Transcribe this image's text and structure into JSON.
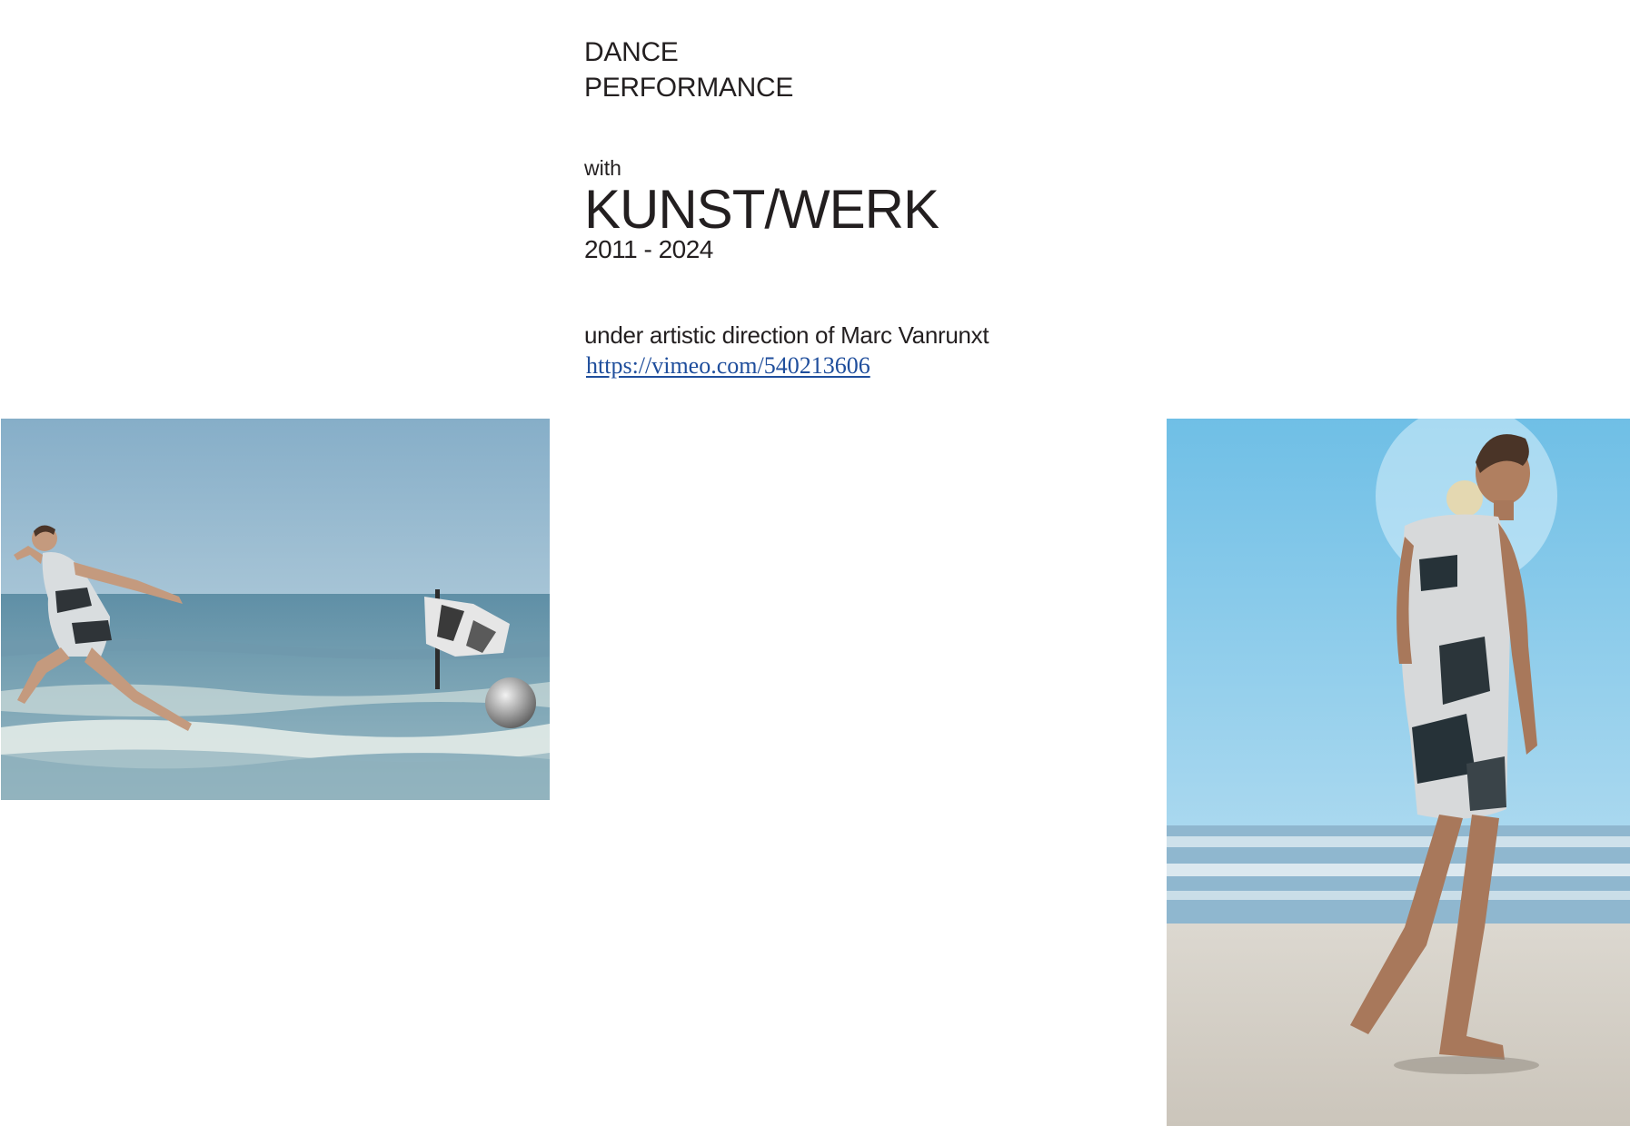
{
  "header": {
    "line1": "DANCE",
    "line2": "PERFORMANCE"
  },
  "intro": {
    "with": "with",
    "company": "KUNST/WERK",
    "years": "2011 - 2024"
  },
  "credits": {
    "direction": "under artistic direction of  Marc Vanrunxt",
    "link_text": "https://vimeo.com/540213606"
  },
  "colors": {
    "text": "#231f20",
    "link": "#1f4e9c"
  }
}
